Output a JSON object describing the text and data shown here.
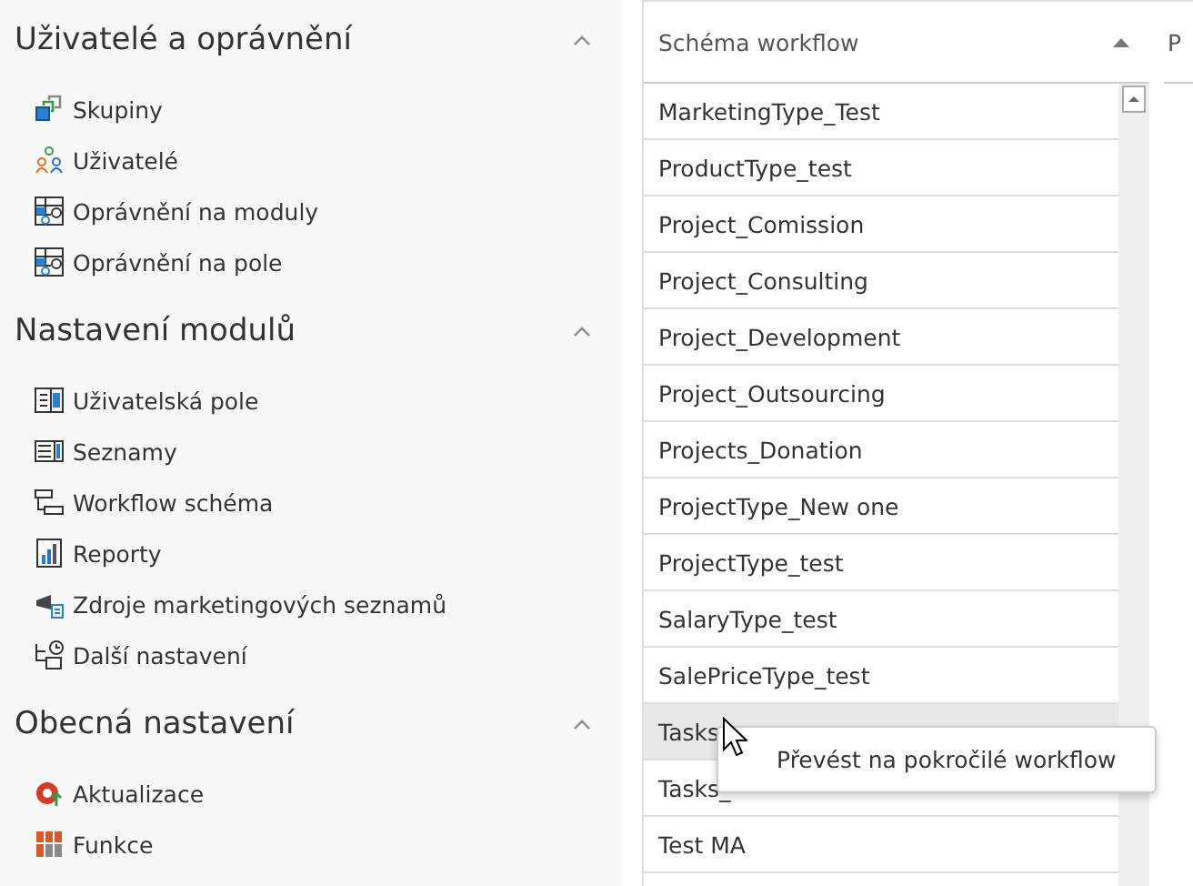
{
  "sidebar": {
    "sections": [
      {
        "title": "Uživatelé a oprávnění",
        "expanded": true,
        "items": [
          {
            "label": "Skupiny"
          },
          {
            "label": "Uživatelé"
          },
          {
            "label": "Oprávnění na moduly"
          },
          {
            "label": "Oprávnění na pole"
          }
        ]
      },
      {
        "title": "Nastavení modulů",
        "expanded": true,
        "items": [
          {
            "label": "Uživatelská pole"
          },
          {
            "label": "Seznamy"
          },
          {
            "label": "Workflow schéma"
          },
          {
            "label": "Reporty"
          },
          {
            "label": "Zdroje marketingových seznamů"
          },
          {
            "label": "Další nastavení"
          }
        ]
      },
      {
        "title": "Obecná nastavení",
        "expanded": true,
        "items": [
          {
            "label": "Aktualizace"
          },
          {
            "label": "Funkce"
          }
        ]
      }
    ]
  },
  "table": {
    "columns": [
      {
        "label": "Schéma workflow",
        "sorted_ascending": true
      },
      {
        "label": "P"
      }
    ],
    "rows": [
      {
        "cell": "MarketingType_Test",
        "selected": false
      },
      {
        "cell": "ProductType_test",
        "selected": false
      },
      {
        "cell": "Project_Comission",
        "selected": false
      },
      {
        "cell": "Project_Consulting",
        "selected": false
      },
      {
        "cell": "Project_Development",
        "selected": false
      },
      {
        "cell": "Project_Outsourcing",
        "selected": false
      },
      {
        "cell": "Projects_Donation",
        "selected": false
      },
      {
        "cell": "ProjectType_New one",
        "selected": false
      },
      {
        "cell": "ProjectType_test",
        "selected": false
      },
      {
        "cell": "SalaryType_test",
        "selected": false
      },
      {
        "cell": "SalePriceType_test",
        "selected": false
      },
      {
        "cell": "Tasks",
        "selected": true
      },
      {
        "cell": "Tasks_",
        "selected": false
      },
      {
        "cell": "Test MA",
        "selected": false
      },
      {
        "selected": false
      }
    ]
  },
  "context_menu": {
    "items": [
      {
        "label": "Převést na pokročilé workflow"
      }
    ]
  }
}
